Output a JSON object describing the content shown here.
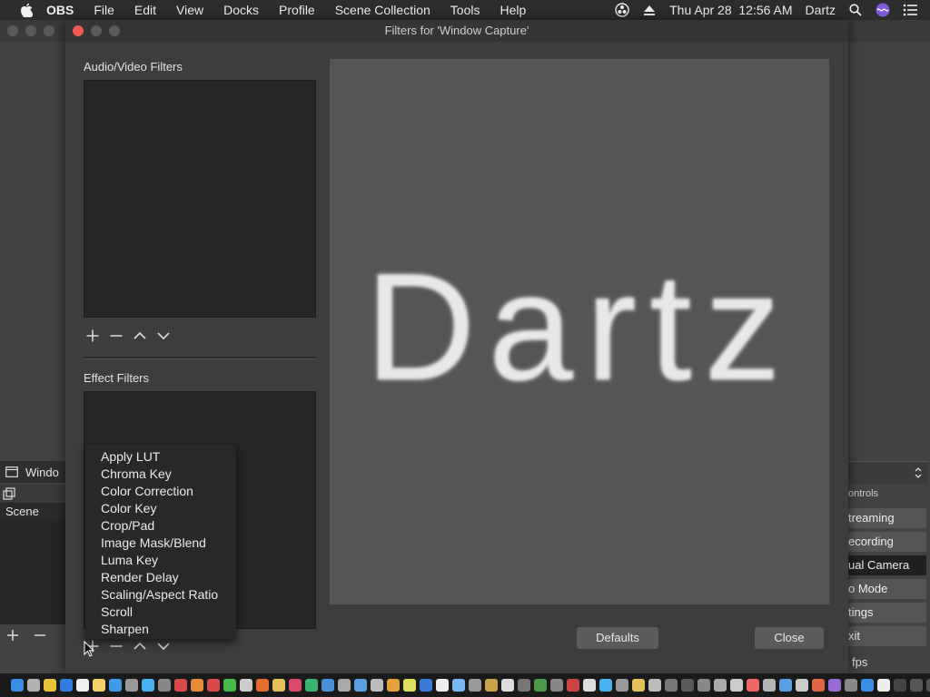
{
  "menubar": {
    "app": "OBS",
    "items": [
      "File",
      "Edit",
      "View",
      "Docks",
      "Profile",
      "Scene Collection",
      "Tools",
      "Help"
    ],
    "datetime": "Thu Apr 28  12:56 AM",
    "user": "Dartz"
  },
  "main": {
    "source_label": "Windo",
    "scene_item": "Scene",
    "controls_label": "ontrols",
    "buttons": [
      "treaming",
      "ecording",
      "ual Camera",
      "o Mode",
      "tings",
      "xit"
    ],
    "fps": "fps"
  },
  "dialog": {
    "title": "Filters for 'Window Capture'",
    "av_filters_label": "Audio/Video Filters",
    "effect_filters_label": "Effect Filters",
    "preview_text": "Dartz",
    "defaults_button": "Defaults",
    "close_button": "Close"
  },
  "dropdown": {
    "items": [
      "Apply LUT",
      "Chroma Key",
      "Color Correction",
      "Color Key",
      "Crop/Pad",
      "Image Mask/Blend",
      "Luma Key",
      "Render Delay",
      "Scaling/Aspect Ratio",
      "Scroll",
      "Sharpen"
    ]
  },
  "colors": {
    "close_red": "#ee5b55",
    "accent_inactive": "#5a5a5a"
  }
}
